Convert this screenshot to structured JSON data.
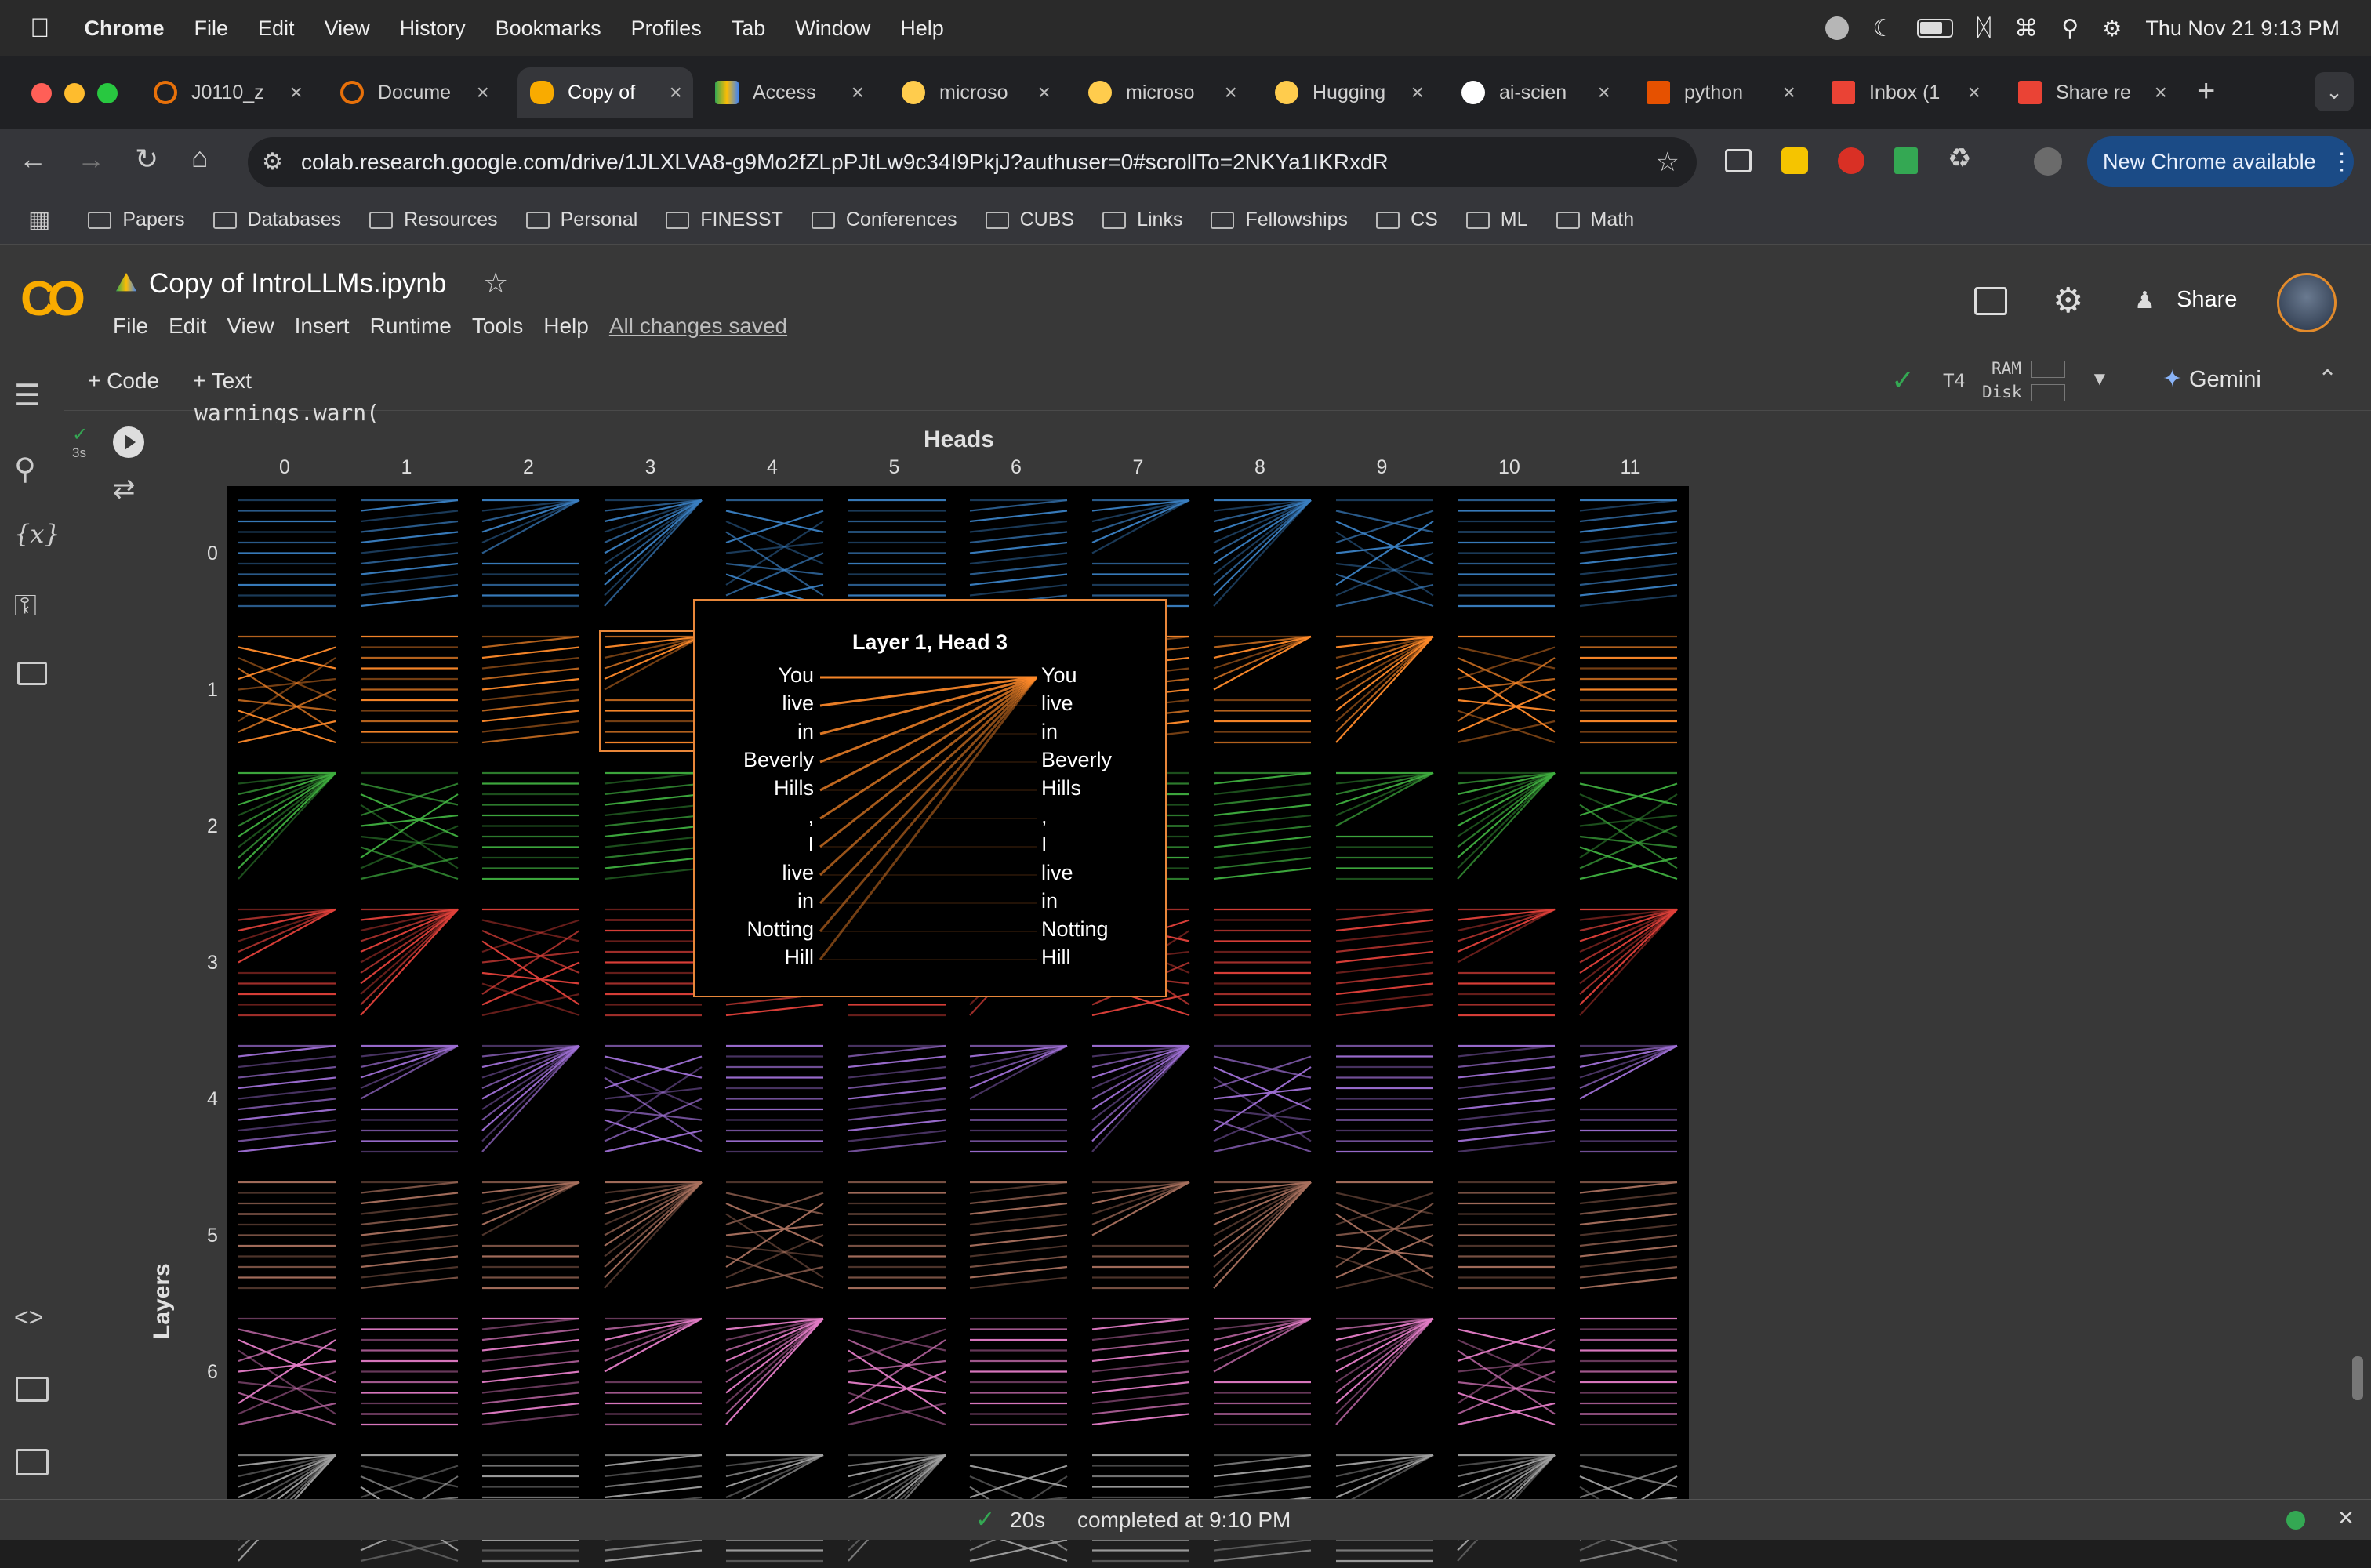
{
  "menubar": {
    "app": "Chrome",
    "items": [
      "File",
      "Edit",
      "View",
      "History",
      "Bookmarks",
      "Profiles",
      "Tab",
      "Window",
      "Help"
    ],
    "datetime": "Thu Nov 21  9:13 PM"
  },
  "tabs": [
    {
      "label": "J0110_z",
      "color": "#e8710a"
    },
    {
      "label": "Docume",
      "color": "#e8710a"
    },
    {
      "label": "Copy of",
      "color": "#f9ab00"
    },
    {
      "label": "Access",
      "color": "#34a853"
    },
    {
      "label": "microso",
      "color": "#ffcc4d"
    },
    {
      "label": "microso",
      "color": "#ffcc4d"
    },
    {
      "label": "Hugging",
      "color": "#ffcc4d"
    },
    {
      "label": "ai-scien",
      "color": "#ffffff"
    },
    {
      "label": "python",
      "color": "#e65100"
    },
    {
      "label": "Inbox (1",
      "color": "#ea4335"
    },
    {
      "label": "Share re",
      "color": "#ea4335"
    }
  ],
  "url": "colab.research.google.com/drive/1JLXLVA8-g9Mo2fZLpPJtLw9c34I9PkjJ?authuser=0#scrollTo=2NKYa1IKRxdR",
  "new_chrome": "New Chrome available",
  "bookmarks": [
    "Papers",
    "Databases",
    "Resources",
    "Personal",
    "FINESST",
    "Conferences",
    "CUBS",
    "Links",
    "Fellowships",
    "CS",
    "ML",
    "Math"
  ],
  "notebook": {
    "title": "Copy of IntroLLMs.ipynb",
    "menus": [
      "File",
      "Edit",
      "View",
      "Insert",
      "Runtime",
      "Tools",
      "Help"
    ],
    "saved": "All changes saved",
    "share": "Share"
  },
  "celltoolbar": {
    "code": "+ Code",
    "text": "+ Text",
    "runtime": "T4",
    "ram": "RAM",
    "disk": "Disk",
    "gemini": "Gemini"
  },
  "cell": {
    "exec_time": "3s",
    "warning": "warnings.warn("
  },
  "plot": {
    "xlabel": "Heads",
    "ylabel": "Layers",
    "heads": [
      "0",
      "1",
      "2",
      "3",
      "4",
      "5",
      "6",
      "7",
      "8",
      "9",
      "10",
      "11"
    ],
    "layers": [
      "0",
      "1",
      "2",
      "3",
      "4",
      "5",
      "6"
    ],
    "layer_colors": [
      "#3a7fc2",
      "#ff8a2a",
      "#3fae3f",
      "#e0403a",
      "#9e6fd4",
      "#a8705e",
      "#e37cc6",
      "#a0a0a0"
    ]
  },
  "popup": {
    "title": "Layer 1, Head 3",
    "tokens": [
      "You",
      "live",
      "in",
      "Beverly",
      "Hills",
      ",",
      "I",
      "live",
      "in",
      "Notting",
      "Hill"
    ]
  },
  "status": {
    "duration": "20s",
    "text": "completed at 9:10 PM"
  }
}
